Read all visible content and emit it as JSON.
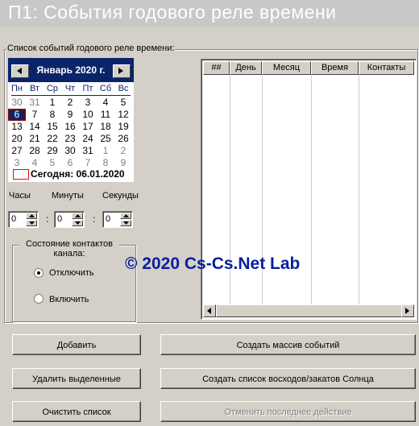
{
  "window": {
    "title": "П1:  События годового реле времени"
  },
  "events_group": {
    "legend": "Список событий годового реле времени:"
  },
  "calendar": {
    "month_label": "Январь 2020 г.",
    "weekdays": [
      "Пн",
      "Вт",
      "Ср",
      "Чт",
      "Пт",
      "Сб",
      "Вс"
    ],
    "weeks": [
      [
        "30",
        "31",
        "1",
        "2",
        "3",
        "4",
        "5"
      ],
      [
        "6",
        "7",
        "8",
        "9",
        "10",
        "11",
        "12"
      ],
      [
        "13",
        "14",
        "15",
        "16",
        "17",
        "18",
        "19"
      ],
      [
        "20",
        "21",
        "22",
        "23",
        "24",
        "25",
        "26"
      ],
      [
        "27",
        "28",
        "29",
        "30",
        "31",
        "1",
        "2"
      ],
      [
        "3",
        "4",
        "5",
        "6",
        "7",
        "8",
        "9"
      ]
    ],
    "selected_day": "6",
    "today_label": "Сегодня: 06.01.2020"
  },
  "time": {
    "hours_label": "Часы",
    "minutes_label": "Минуты",
    "seconds_label": "Секунды",
    "hours_value": "0",
    "minutes_value": "0",
    "seconds_value": "0",
    "separator": ":"
  },
  "contacts": {
    "legend": "Состояние контактов канала:",
    "options": [
      {
        "label": "Отключить",
        "checked": true
      },
      {
        "label": "Включить",
        "checked": false
      }
    ]
  },
  "table": {
    "columns": [
      "##",
      "День",
      "Месяц",
      "Время",
      "Контакты"
    ],
    "rows": []
  },
  "buttons": {
    "add": "Добавить",
    "create_array": "Создать массив событий",
    "delete_selected": "Удалить выделенные",
    "create_sun_list": "Создать список восходов/закатов Солнца",
    "clear_list": "Очистить список",
    "undo_last": "Отменить последнее действие"
  },
  "watermark": "© 2020 Cs-Cs.Net Lab"
}
